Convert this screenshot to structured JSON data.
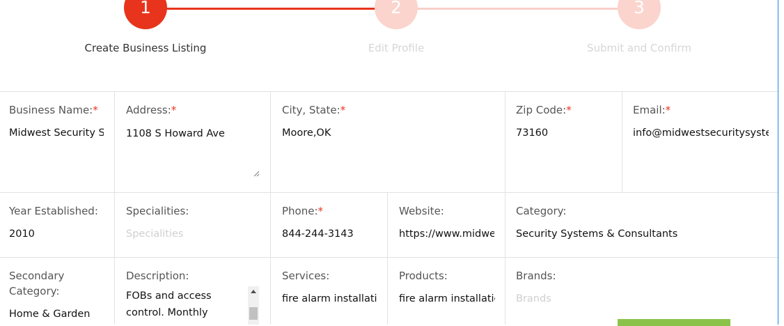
{
  "stepper": {
    "steps": [
      {
        "number": "1",
        "label": "Create Business Listing",
        "state": "active"
      },
      {
        "number": "2",
        "label": "Edit Profile",
        "state": "inactive"
      },
      {
        "number": "3",
        "label": "Submit and Confirm",
        "state": "inactive"
      }
    ]
  },
  "colors": {
    "accent": "#e8341c",
    "accent_light": "#fbd4cd",
    "button_green": "#8bc34a"
  },
  "form": {
    "business_name": {
      "label": "Business Name:",
      "required": "*",
      "value": "Midwest Security S"
    },
    "address": {
      "label": "Address:",
      "required": "*",
      "value": "1108 S Howard Ave"
    },
    "city_state": {
      "label": "City, State:",
      "required": "*",
      "value": "Moore,OK"
    },
    "zip": {
      "label": "Zip Code:",
      "required": "*",
      "value": "73160"
    },
    "email": {
      "label": "Email:",
      "required": "*",
      "value": "info@midwestsecuritysyste"
    },
    "year": {
      "label": "Year Established:",
      "value": "2010"
    },
    "specialities": {
      "label": "Specialities:",
      "placeholder": "Specialities"
    },
    "phone": {
      "label": "Phone:",
      "required": "*",
      "value": "844-244-3143"
    },
    "website": {
      "label": "Website:",
      "value": "https://www.midwe"
    },
    "category": {
      "label": "Category:",
      "value": "Security Systems & Consultants"
    },
    "secondary_category": {
      "label_line1": "Secondary",
      "label_line2": "Category:",
      "value": "Home & Garden"
    },
    "description": {
      "label": "Description:",
      "value_line1": "FOBs and access",
      "value_line2": "control. Monthly"
    },
    "services": {
      "label": "Services:",
      "value": "fire alarm installatic"
    },
    "products": {
      "label": "Products:",
      "value": "fire alarm installatic"
    },
    "brands": {
      "label": "Brands:",
      "placeholder": "Brands"
    }
  }
}
